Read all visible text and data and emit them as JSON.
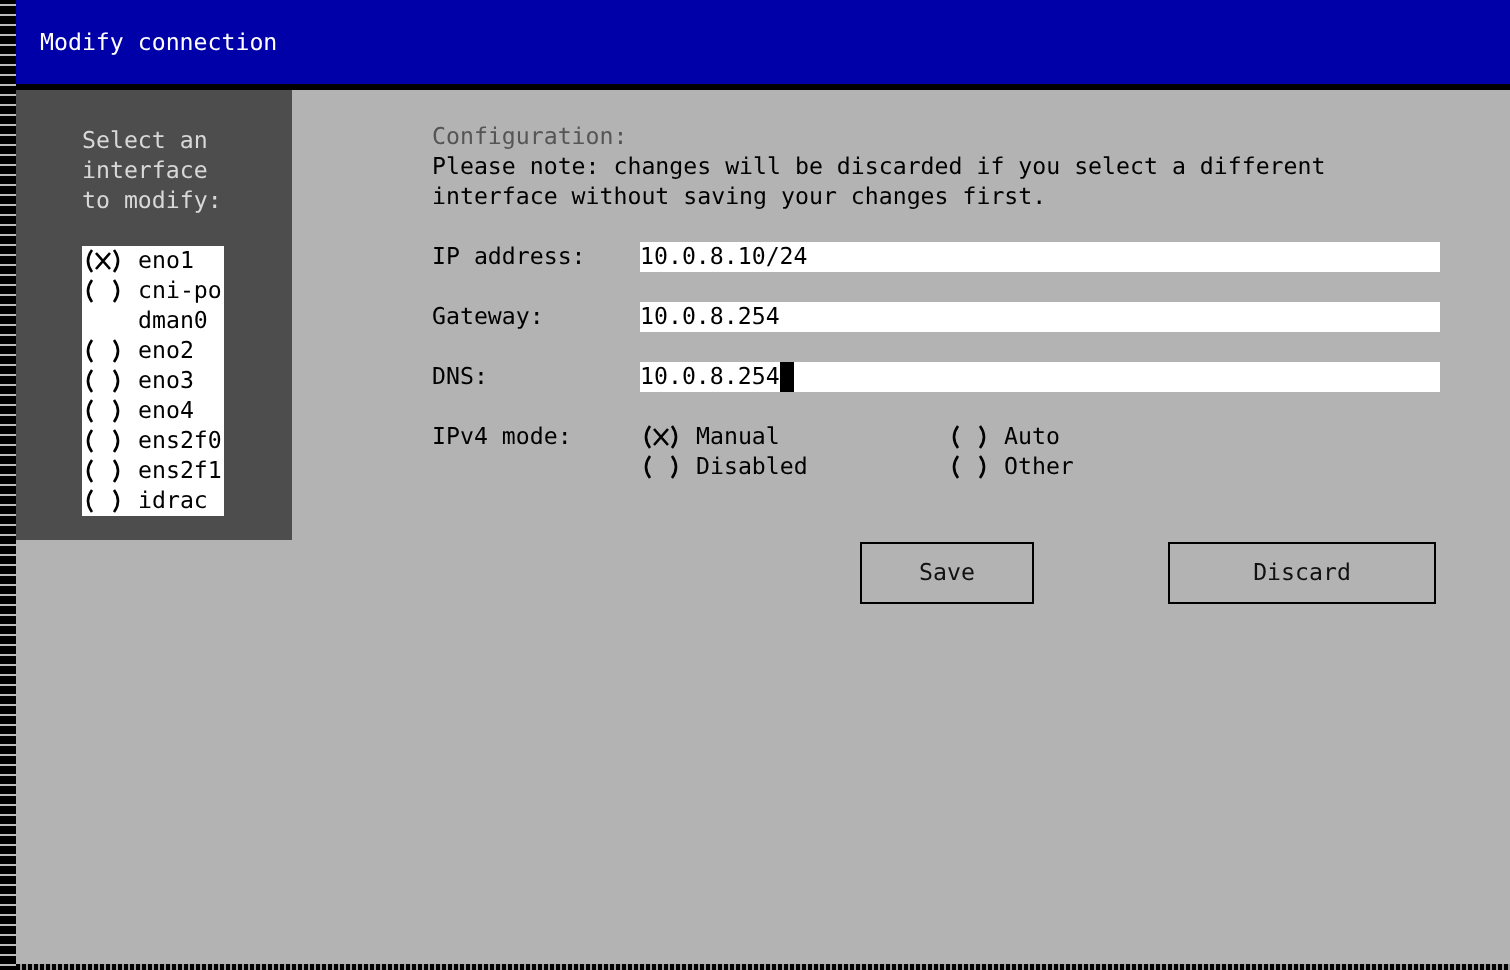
{
  "window": {
    "title": "Modify connection"
  },
  "sidebar": {
    "prompt": "Select an interface to modify:",
    "items": [
      {
        "label": "eno1",
        "selected": true
      },
      {
        "label": "cni-podman0",
        "selected": false
      },
      {
        "label": "eno2",
        "selected": false
      },
      {
        "label": "eno3",
        "selected": false
      },
      {
        "label": "eno4",
        "selected": false
      },
      {
        "label": "ens2f0",
        "selected": false
      },
      {
        "label": "ens2f1",
        "selected": false
      },
      {
        "label": "idrac",
        "selected": false
      }
    ]
  },
  "config": {
    "heading": "Configuration:",
    "note": "Please note: changes will be discarded if you select a different interface without saving your changes first.",
    "fields": [
      {
        "label": "IP address:",
        "value": "10.0.8.10/24",
        "focused": false
      },
      {
        "label": "Gateway:",
        "value": "10.0.8.254",
        "focused": false
      },
      {
        "label": "DNS:",
        "value": "10.0.8.254",
        "focused": true
      }
    ],
    "mode": {
      "label": "IPv4 mode:",
      "options": [
        {
          "label": "Manual",
          "selected": true
        },
        {
          "label": "Auto",
          "selected": false
        },
        {
          "label": "Disabled",
          "selected": false
        },
        {
          "label": "Other",
          "selected": false
        }
      ]
    }
  },
  "buttons": [
    {
      "label": "Save"
    },
    {
      "label": "Discard"
    }
  ]
}
